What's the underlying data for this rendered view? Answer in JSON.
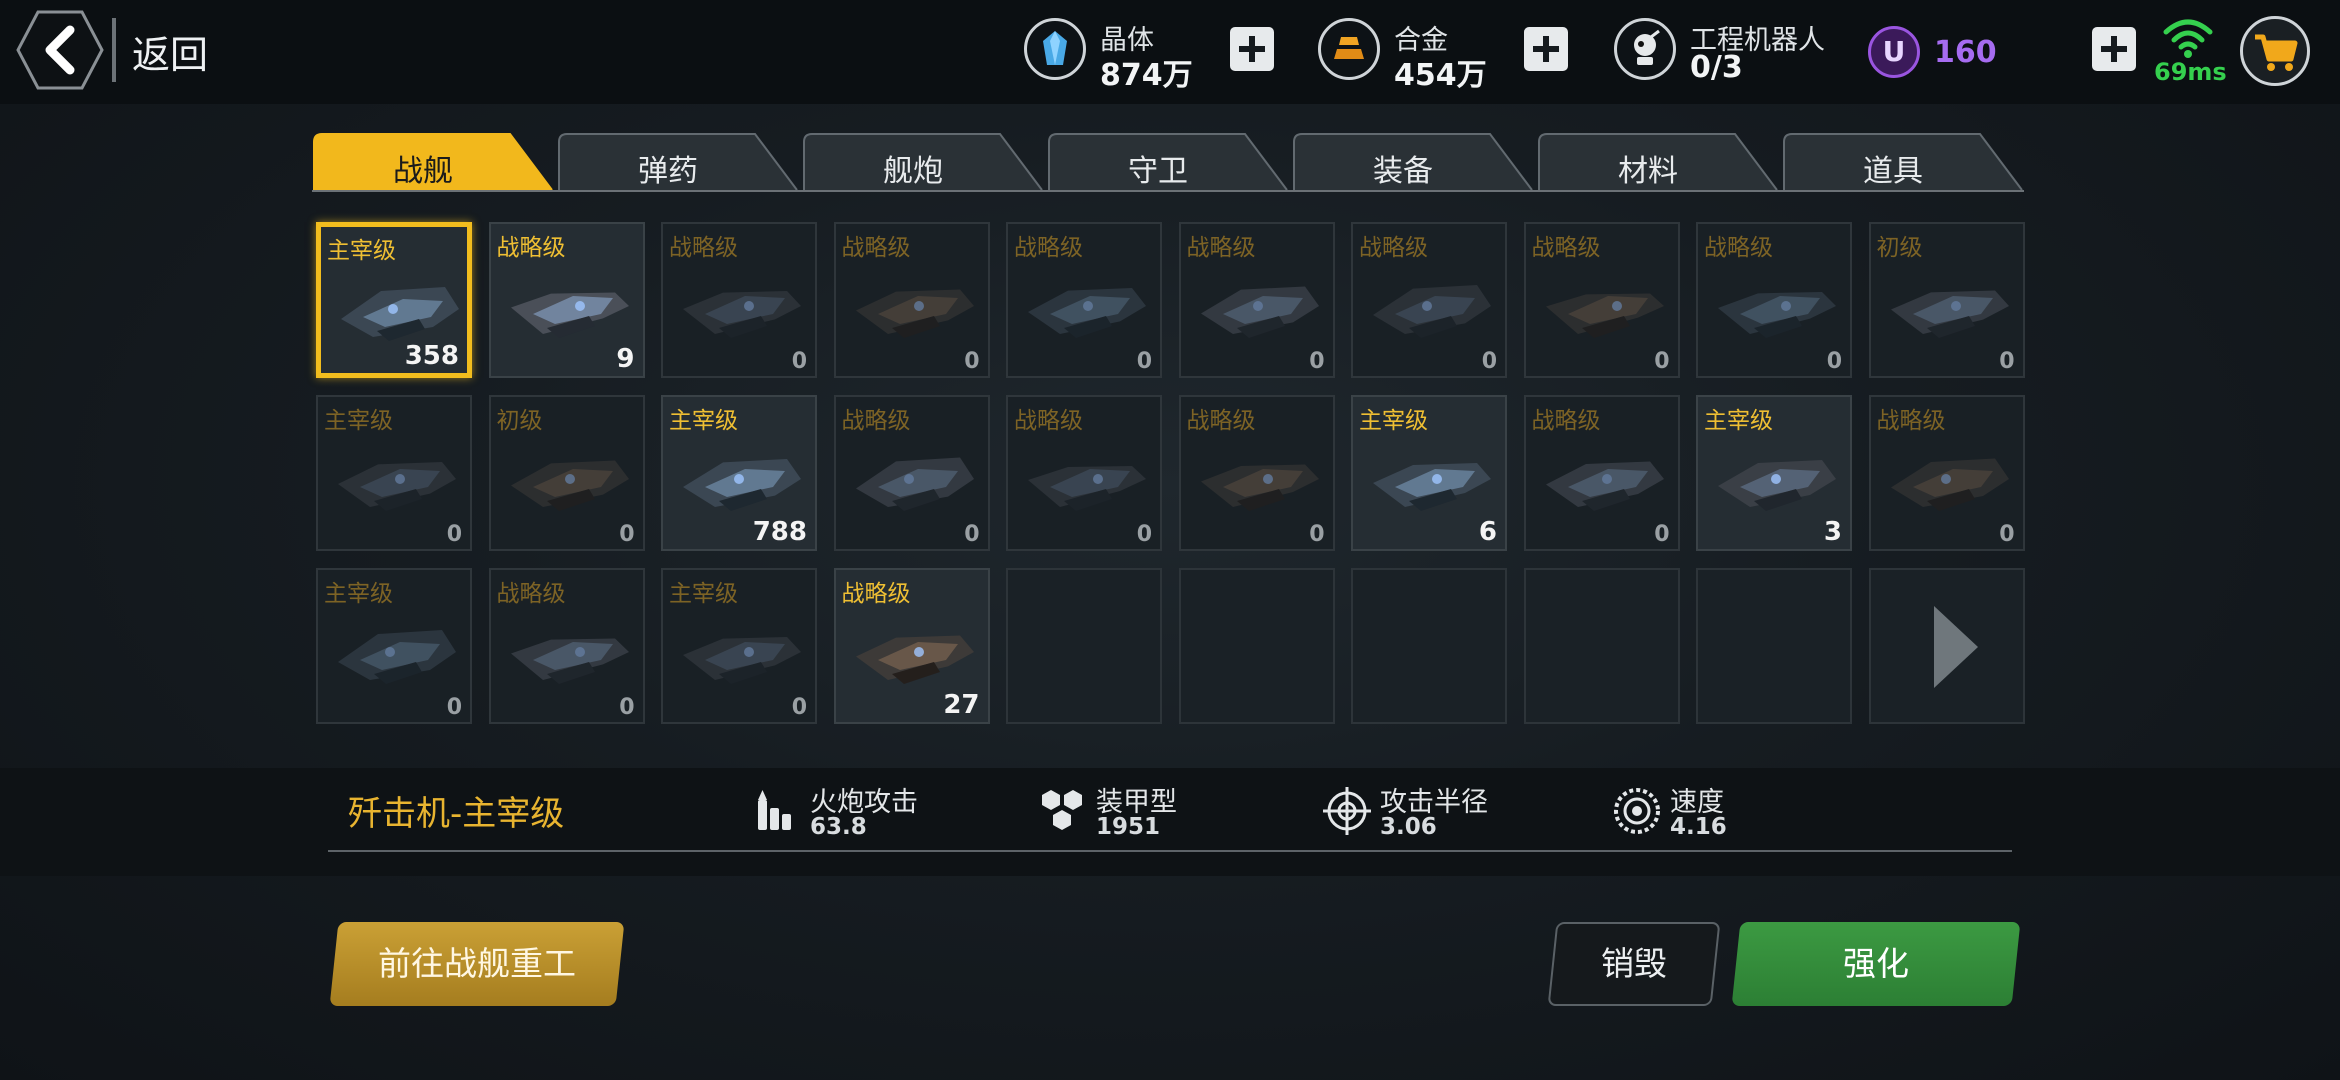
{
  "header": {
    "back_label": "返回",
    "resources": [
      {
        "name": "晶体",
        "value": "874万",
        "icon": "crystal-icon"
      },
      {
        "name": "合金",
        "value": "454万",
        "icon": "alloy-icon"
      },
      {
        "name": "工程机器人",
        "value": "0/3",
        "icon": "robot-icon"
      }
    ],
    "premium": {
      "icon_letter": "U",
      "value": "160"
    },
    "ping": "69ms",
    "colors": {
      "premium": "#a66cf0",
      "ping": "#35d04e",
      "accent": "#f2bd1e"
    }
  },
  "tabs": [
    {
      "label": "战舰",
      "active": true
    },
    {
      "label": "弹药",
      "active": false
    },
    {
      "label": "舰炮",
      "active": false
    },
    {
      "label": "守卫",
      "active": false
    },
    {
      "label": "装备",
      "active": false
    },
    {
      "label": "材料",
      "active": false
    },
    {
      "label": "道具",
      "active": false
    }
  ],
  "ships": [
    {
      "grade": "主宰级",
      "count": "358",
      "owned": true,
      "selected": true
    },
    {
      "grade": "战略级",
      "count": "9",
      "owned": true
    },
    {
      "grade": "战略级",
      "count": "0"
    },
    {
      "grade": "战略级",
      "count": "0"
    },
    {
      "grade": "战略级",
      "count": "0"
    },
    {
      "grade": "战略级",
      "count": "0"
    },
    {
      "grade": "战略级",
      "count": "0"
    },
    {
      "grade": "战略级",
      "count": "0"
    },
    {
      "grade": "战略级",
      "count": "0"
    },
    {
      "grade": "初级",
      "count": "0"
    },
    {
      "grade": "主宰级",
      "count": "0"
    },
    {
      "grade": "初级",
      "count": "0"
    },
    {
      "grade": "主宰级",
      "count": "788",
      "owned": true
    },
    {
      "grade": "战略级",
      "count": "0"
    },
    {
      "grade": "战略级",
      "count": "0"
    },
    {
      "grade": "战略级",
      "count": "0"
    },
    {
      "grade": "主宰级",
      "count": "6",
      "owned": true
    },
    {
      "grade": "战略级",
      "count": "0"
    },
    {
      "grade": "主宰级",
      "count": "3",
      "owned": true
    },
    {
      "grade": "战略级",
      "count": "0"
    },
    {
      "grade": "主宰级",
      "count": "0"
    },
    {
      "grade": "战略级",
      "count": "0"
    },
    {
      "grade": "主宰级",
      "count": "0"
    },
    {
      "grade": "战略级",
      "count": "27",
      "owned": true
    }
  ],
  "detail": {
    "ship_name": "歼击机-主宰级",
    "stats": [
      {
        "label": "火炮攻击",
        "value": "63.8",
        "icon": "ammo-icon"
      },
      {
        "label": "装甲型",
        "value": "1951",
        "icon": "armor-icon"
      },
      {
        "label": "攻击半径",
        "value": "3.06",
        "icon": "crosshair-icon"
      },
      {
        "label": "速度",
        "value": "4.16",
        "icon": "speed-icon"
      }
    ]
  },
  "buttons": {
    "goto": "前往战舰重工",
    "destroy": "销毁",
    "upgrade": "强化"
  }
}
